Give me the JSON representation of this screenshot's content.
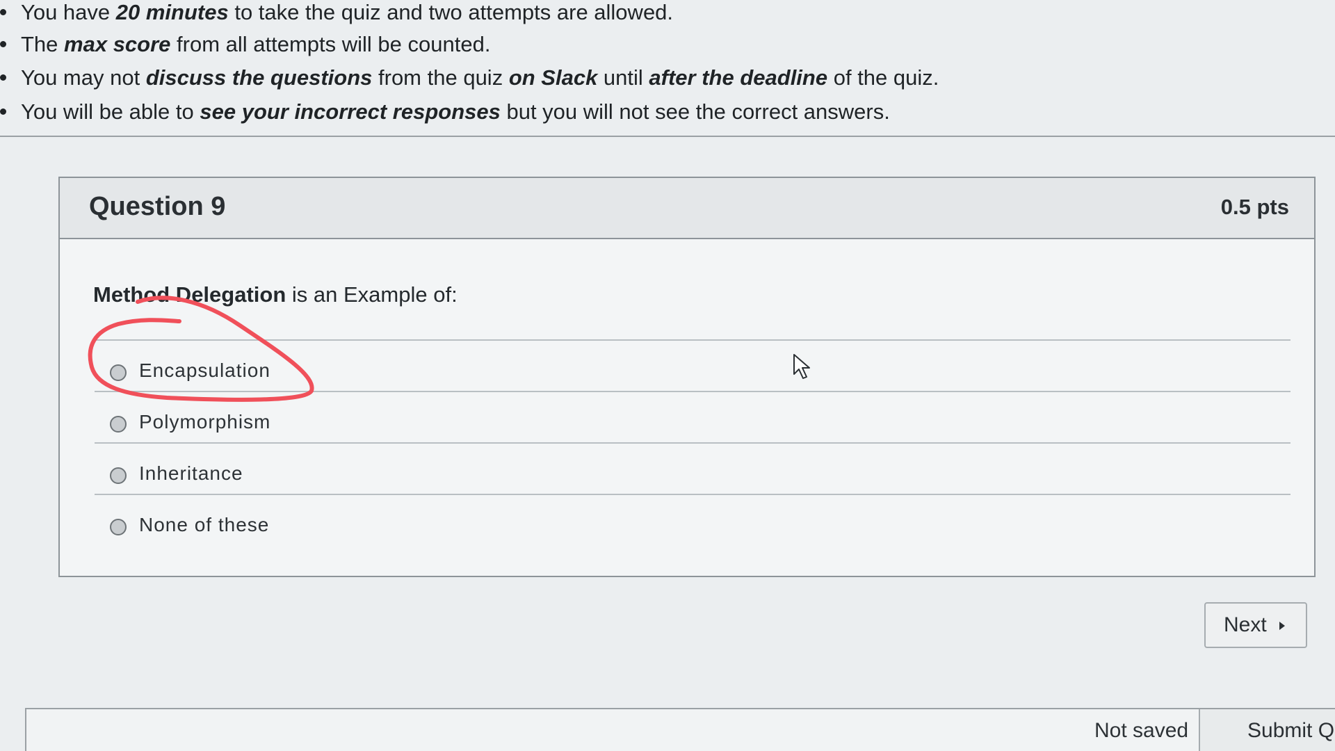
{
  "instructions": {
    "items": [
      {
        "a": "You have ",
        "b": "20 minutes",
        "c": " to take the quiz and two attempts are allowed.",
        "d": "",
        "e": "",
        "f": "",
        "g": ""
      },
      {
        "a": "The ",
        "b": "max score",
        "c": " from all attempts will be counted.",
        "d": "",
        "e": "",
        "f": "",
        "g": ""
      },
      {
        "a": "You may not ",
        "b": "discuss the questions",
        "c": " from the quiz ",
        "d": "on Slack",
        "e": " until ",
        "f": "after the deadline",
        "g": " of the quiz."
      },
      {
        "a": "You will be able to ",
        "b": "see your incorrect responses",
        "c": " but you will not see the correct answers.",
        "d": "",
        "e": "",
        "f": "",
        "g": ""
      }
    ]
  },
  "question": {
    "title": "Question 9",
    "points": "0.5 pts",
    "text_bold": "Method Delegation",
    "text_rest": " is an Example of:",
    "answers": [
      {
        "label": "Encapsulation"
      },
      {
        "label": "Polymorphism"
      },
      {
        "label": "Inheritance"
      },
      {
        "label": "None of these"
      }
    ]
  },
  "navigation": {
    "next_label": "Next"
  },
  "footer": {
    "save_status": "Not saved",
    "submit_label": "Submit Quiz"
  },
  "colors": {
    "annotation": "#f0505a"
  }
}
